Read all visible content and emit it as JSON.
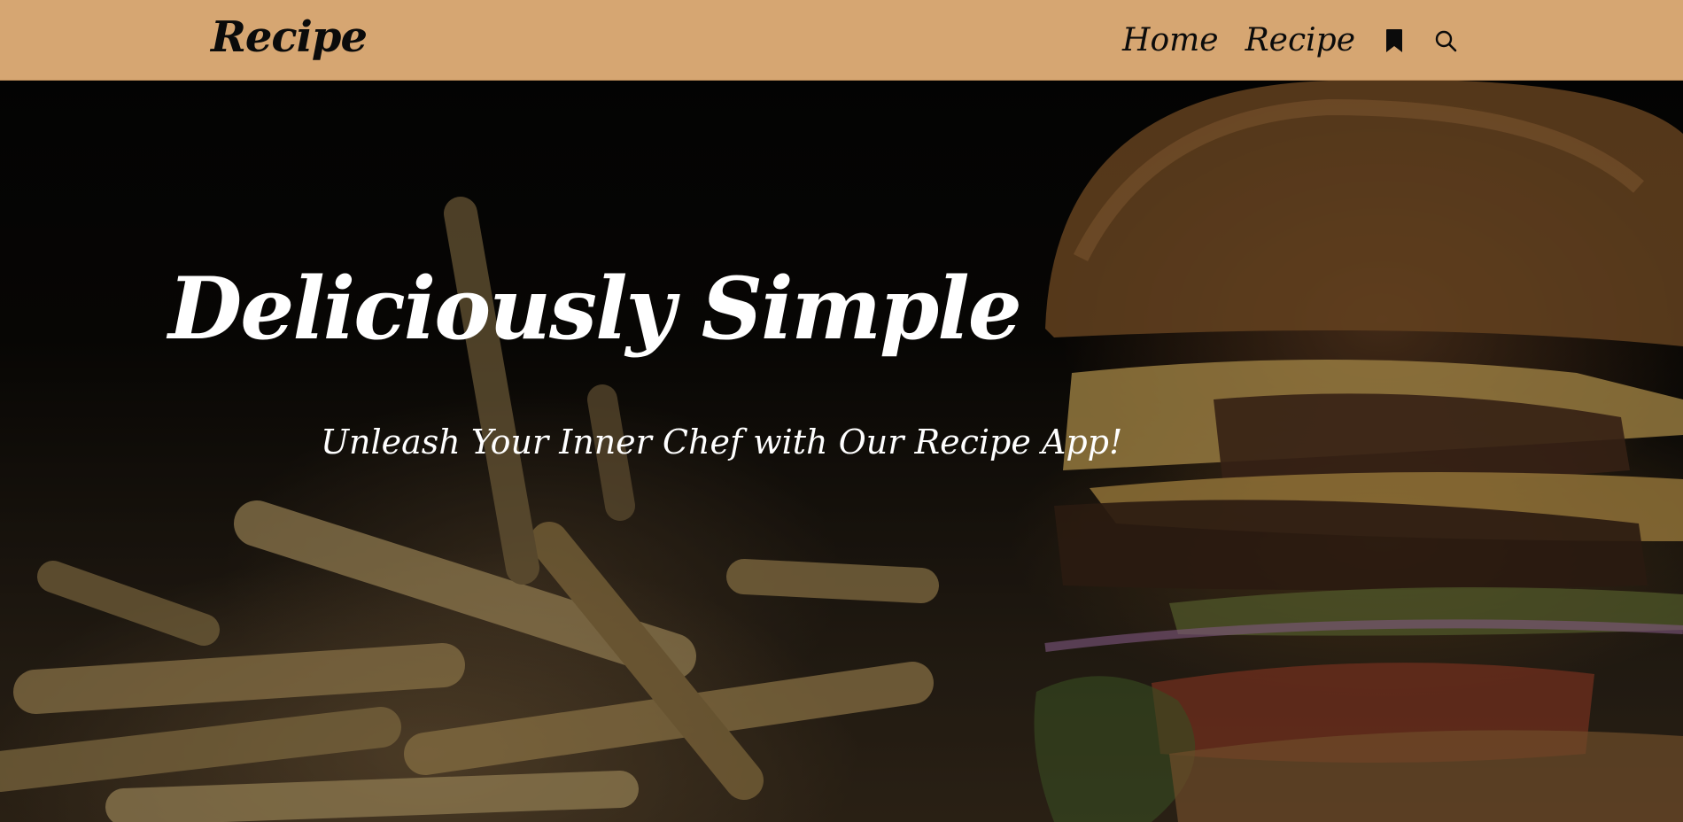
{
  "brand": {
    "logo_text": "Recipe"
  },
  "nav": {
    "items": [
      {
        "label": "Home"
      },
      {
        "label": "Recipe"
      }
    ],
    "bookmark_icon": "bookmark-icon",
    "search_icon": "search-icon"
  },
  "hero": {
    "title": "Deliciously Simple",
    "subtitle": "Unleash Your Inner Chef with Our Recipe App!",
    "background_image": "burger-and-fries-photo"
  },
  "colors": {
    "navbar_bg": "#d6a672",
    "nav_text": "#0b0b0b",
    "hero_text": "#ffffff"
  }
}
